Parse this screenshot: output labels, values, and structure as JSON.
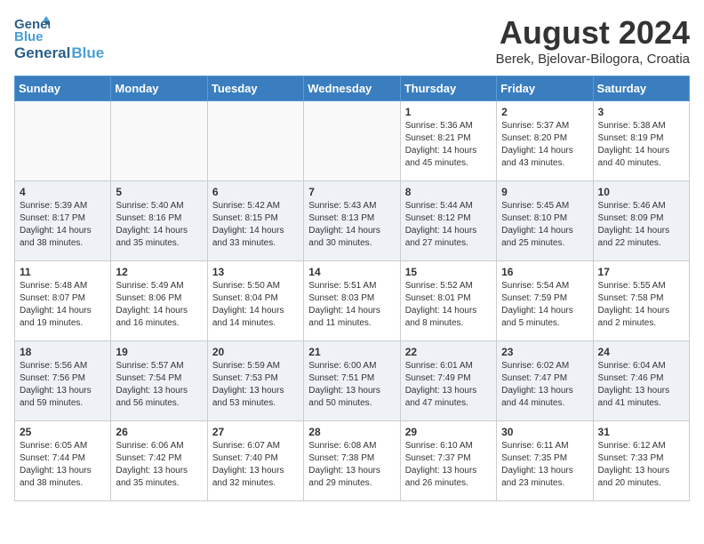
{
  "header": {
    "logo_line1": "General",
    "logo_line2": "Blue",
    "title": "August 2024",
    "subtitle": "Berek, Bjelovar-Bilogora, Croatia"
  },
  "weekdays": [
    "Sunday",
    "Monday",
    "Tuesday",
    "Wednesday",
    "Thursday",
    "Friday",
    "Saturday"
  ],
  "weeks": [
    [
      {
        "day": "",
        "info": ""
      },
      {
        "day": "",
        "info": ""
      },
      {
        "day": "",
        "info": ""
      },
      {
        "day": "",
        "info": ""
      },
      {
        "day": "1",
        "info": "Sunrise: 5:36 AM\nSunset: 8:21 PM\nDaylight: 14 hours\nand 45 minutes."
      },
      {
        "day": "2",
        "info": "Sunrise: 5:37 AM\nSunset: 8:20 PM\nDaylight: 14 hours\nand 43 minutes."
      },
      {
        "day": "3",
        "info": "Sunrise: 5:38 AM\nSunset: 8:19 PM\nDaylight: 14 hours\nand 40 minutes."
      }
    ],
    [
      {
        "day": "4",
        "info": "Sunrise: 5:39 AM\nSunset: 8:17 PM\nDaylight: 14 hours\nand 38 minutes."
      },
      {
        "day": "5",
        "info": "Sunrise: 5:40 AM\nSunset: 8:16 PM\nDaylight: 14 hours\nand 35 minutes."
      },
      {
        "day": "6",
        "info": "Sunrise: 5:42 AM\nSunset: 8:15 PM\nDaylight: 14 hours\nand 33 minutes."
      },
      {
        "day": "7",
        "info": "Sunrise: 5:43 AM\nSunset: 8:13 PM\nDaylight: 14 hours\nand 30 minutes."
      },
      {
        "day": "8",
        "info": "Sunrise: 5:44 AM\nSunset: 8:12 PM\nDaylight: 14 hours\nand 27 minutes."
      },
      {
        "day": "9",
        "info": "Sunrise: 5:45 AM\nSunset: 8:10 PM\nDaylight: 14 hours\nand 25 minutes."
      },
      {
        "day": "10",
        "info": "Sunrise: 5:46 AM\nSunset: 8:09 PM\nDaylight: 14 hours\nand 22 minutes."
      }
    ],
    [
      {
        "day": "11",
        "info": "Sunrise: 5:48 AM\nSunset: 8:07 PM\nDaylight: 14 hours\nand 19 minutes."
      },
      {
        "day": "12",
        "info": "Sunrise: 5:49 AM\nSunset: 8:06 PM\nDaylight: 14 hours\nand 16 minutes."
      },
      {
        "day": "13",
        "info": "Sunrise: 5:50 AM\nSunset: 8:04 PM\nDaylight: 14 hours\nand 14 minutes."
      },
      {
        "day": "14",
        "info": "Sunrise: 5:51 AM\nSunset: 8:03 PM\nDaylight: 14 hours\nand 11 minutes."
      },
      {
        "day": "15",
        "info": "Sunrise: 5:52 AM\nSunset: 8:01 PM\nDaylight: 14 hours\nand 8 minutes."
      },
      {
        "day": "16",
        "info": "Sunrise: 5:54 AM\nSunset: 7:59 PM\nDaylight: 14 hours\nand 5 minutes."
      },
      {
        "day": "17",
        "info": "Sunrise: 5:55 AM\nSunset: 7:58 PM\nDaylight: 14 hours\nand 2 minutes."
      }
    ],
    [
      {
        "day": "18",
        "info": "Sunrise: 5:56 AM\nSunset: 7:56 PM\nDaylight: 13 hours\nand 59 minutes."
      },
      {
        "day": "19",
        "info": "Sunrise: 5:57 AM\nSunset: 7:54 PM\nDaylight: 13 hours\nand 56 minutes."
      },
      {
        "day": "20",
        "info": "Sunrise: 5:59 AM\nSunset: 7:53 PM\nDaylight: 13 hours\nand 53 minutes."
      },
      {
        "day": "21",
        "info": "Sunrise: 6:00 AM\nSunset: 7:51 PM\nDaylight: 13 hours\nand 50 minutes."
      },
      {
        "day": "22",
        "info": "Sunrise: 6:01 AM\nSunset: 7:49 PM\nDaylight: 13 hours\nand 47 minutes."
      },
      {
        "day": "23",
        "info": "Sunrise: 6:02 AM\nSunset: 7:47 PM\nDaylight: 13 hours\nand 44 minutes."
      },
      {
        "day": "24",
        "info": "Sunrise: 6:04 AM\nSunset: 7:46 PM\nDaylight: 13 hours\nand 41 minutes."
      }
    ],
    [
      {
        "day": "25",
        "info": "Sunrise: 6:05 AM\nSunset: 7:44 PM\nDaylight: 13 hours\nand 38 minutes."
      },
      {
        "day": "26",
        "info": "Sunrise: 6:06 AM\nSunset: 7:42 PM\nDaylight: 13 hours\nand 35 minutes."
      },
      {
        "day": "27",
        "info": "Sunrise: 6:07 AM\nSunset: 7:40 PM\nDaylight: 13 hours\nand 32 minutes."
      },
      {
        "day": "28",
        "info": "Sunrise: 6:08 AM\nSunset: 7:38 PM\nDaylight: 13 hours\nand 29 minutes."
      },
      {
        "day": "29",
        "info": "Sunrise: 6:10 AM\nSunset: 7:37 PM\nDaylight: 13 hours\nand 26 minutes."
      },
      {
        "day": "30",
        "info": "Sunrise: 6:11 AM\nSunset: 7:35 PM\nDaylight: 13 hours\nand 23 minutes."
      },
      {
        "day": "31",
        "info": "Sunrise: 6:12 AM\nSunset: 7:33 PM\nDaylight: 13 hours\nand 20 minutes."
      }
    ]
  ]
}
